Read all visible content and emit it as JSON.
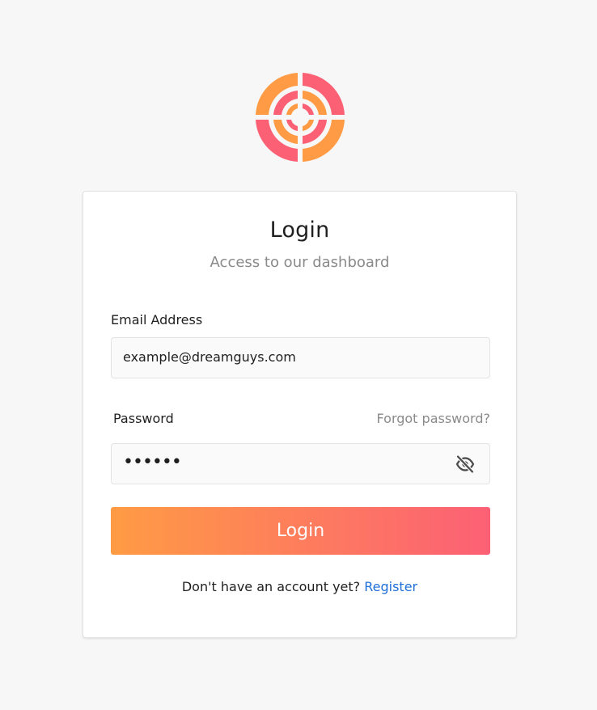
{
  "logo": {
    "icon": "target-logo-icon",
    "colors": [
      "#ff9b44",
      "#fc6075"
    ]
  },
  "login": {
    "title": "Login",
    "subtitle": "Access to our dashboard",
    "email_label": "Email Address",
    "email_value": "example@dreamguys.com",
    "password_label": "Password",
    "forgot_label": "Forgot password?",
    "password_masked": "••••••",
    "toggle_icon": "eye-slash-icon",
    "submit_label": "Login",
    "register_prompt": "Don't have an account yet?",
    "register_label": "Register"
  },
  "colors": {
    "background": "#f7f7f7",
    "gradient_start": "#ff9b44",
    "gradient_end": "#fc6075",
    "link": "#1f6fd8"
  }
}
